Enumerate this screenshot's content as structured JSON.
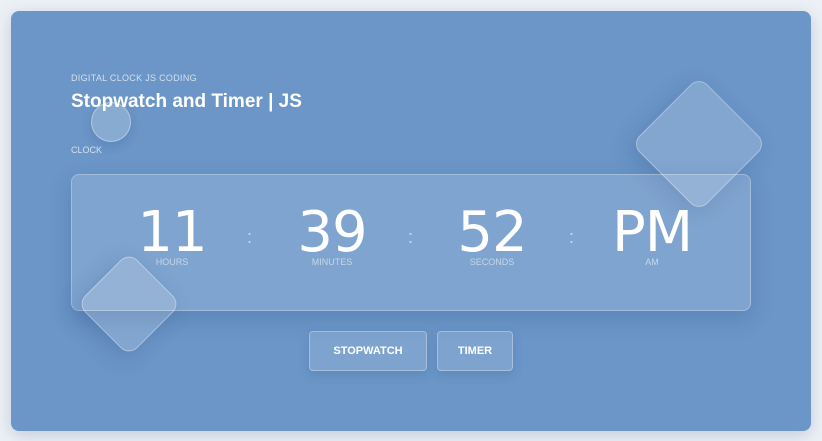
{
  "header": {
    "subtitle": "DIGITAL CLOCK JS CODING",
    "title": "Stopwatch and Timer | JS"
  },
  "section": {
    "label": "CLOCK"
  },
  "clock": {
    "hours": {
      "value": "11",
      "label": "HOURS"
    },
    "minutes": {
      "value": "39",
      "label": "MINUTES"
    },
    "seconds": {
      "value": "52",
      "label": "SECONDS"
    },
    "period": {
      "value": "PM",
      "label": "AM"
    },
    "separator": ":"
  },
  "buttons": {
    "stopwatch": "STOPWATCH",
    "timer": "TIMER"
  },
  "colors": {
    "background": "#6b96c7",
    "page": "#edf1f6",
    "text": "#ffffff"
  }
}
